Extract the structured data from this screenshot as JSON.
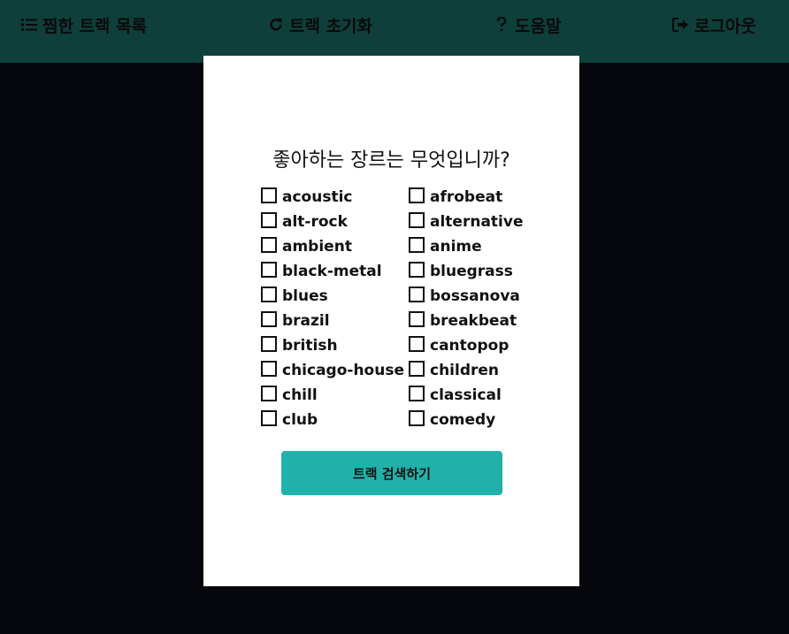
{
  "nav": {
    "liked": {
      "label": "찜한 트랙 목록",
      "icon": "list-icon"
    },
    "reset": {
      "label": "트랙 초기화",
      "icon": "refresh-icon"
    },
    "help": {
      "label": "도움말",
      "icon": "question-icon"
    },
    "logout": {
      "label": "로그아웃",
      "icon": "logout-icon"
    }
  },
  "colors": {
    "topbar": "#0f3f3a",
    "background": "#05070c",
    "button": "#20b2aa"
  },
  "form": {
    "question": "좋아하는 장르는 무엇입니까?",
    "genres": [
      {
        "label": "acoustic",
        "checked": false
      },
      {
        "label": "afrobeat",
        "checked": false
      },
      {
        "label": "alt-rock",
        "checked": false
      },
      {
        "label": "alternative",
        "checked": false
      },
      {
        "label": "ambient",
        "checked": false
      },
      {
        "label": "anime",
        "checked": false
      },
      {
        "label": "black-metal",
        "checked": false
      },
      {
        "label": "bluegrass",
        "checked": false
      },
      {
        "label": "blues",
        "checked": false
      },
      {
        "label": "bossanova",
        "checked": false
      },
      {
        "label": "brazil",
        "checked": false
      },
      {
        "label": "breakbeat",
        "checked": false
      },
      {
        "label": "british",
        "checked": false
      },
      {
        "label": "cantopop",
        "checked": false
      },
      {
        "label": "chicago-house",
        "checked": false
      },
      {
        "label": "children",
        "checked": false
      },
      {
        "label": "chill",
        "checked": false
      },
      {
        "label": "classical",
        "checked": false
      },
      {
        "label": "club",
        "checked": false
      },
      {
        "label": "comedy",
        "checked": false
      }
    ],
    "submit_label": "트랙 검색하기"
  }
}
